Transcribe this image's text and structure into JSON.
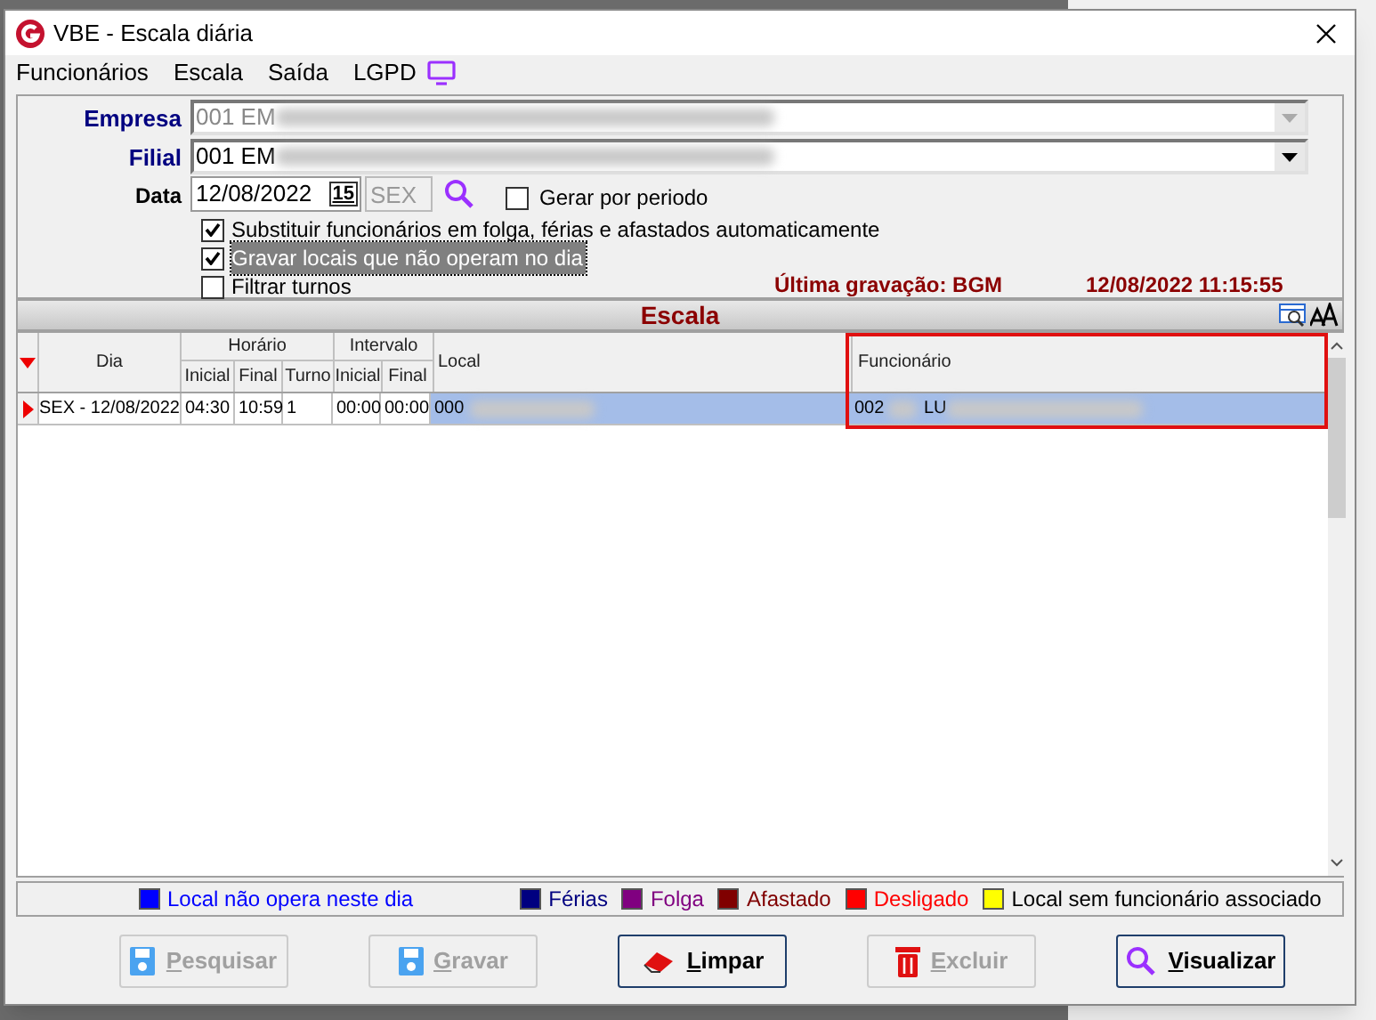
{
  "window": {
    "title": "VBE - Escala diária"
  },
  "menu": [
    "Funcionários",
    "Escala",
    "Saída",
    "LGPD"
  ],
  "form": {
    "empresa": {
      "label": "Empresa",
      "value": "001 EM",
      "disabled": true
    },
    "filial": {
      "label": "Filial",
      "value": "001 EM",
      "disabled": false
    },
    "data": {
      "label": "Data",
      "value": "12/08/2022",
      "calendar": "15",
      "weekday": "SEX"
    },
    "gerar_por_periodo": {
      "label": "Gerar por periodo",
      "checked": false
    },
    "options": [
      {
        "label": "Substituir funcionários em folga, férias e afastados automaticamente",
        "checked": true,
        "focused": false
      },
      {
        "label": "Gravar locais que não operam no dia",
        "checked": true,
        "focused": true
      },
      {
        "label": "Filtrar turnos",
        "checked": false,
        "focused": false
      }
    ],
    "last_save": {
      "label": "Última gravação: BGM",
      "timestamp": "12/08/2022 11:15:55"
    }
  },
  "grid": {
    "title": "Escala",
    "headers": {
      "dia": "Dia",
      "horario": "Horário",
      "intervalo": "Intervalo",
      "inicial": "Inicial",
      "final": "Final",
      "turno": "Turno",
      "inicial_2": "Inicial",
      "final_2": "Final",
      "local": "Local",
      "funcionario": "Funcionário"
    },
    "rows": [
      {
        "selected": true,
        "dia": "SEX - 12/08/2022",
        "inicial": "04:30",
        "final": "10:59",
        "turno": "1",
        "inicial_2": "00:00",
        "final_2": "00:00",
        "local": "000",
        "funcionario": "002",
        "funcionario_name": "LU"
      }
    ]
  },
  "legend": [
    {
      "label": "Local não opera neste dia",
      "color": "#0000ff"
    },
    {
      "label": "Férias",
      "color": "#000080"
    },
    {
      "label": "Folga",
      "color": "#800080"
    },
    {
      "label": "Afastado",
      "color": "#800000"
    },
    {
      "label": "Desligado",
      "color": "#ff0000"
    },
    {
      "label": "Local sem funcionário associado",
      "color": "#ffff00"
    }
  ],
  "buttons": [
    {
      "label": "Pesquisar",
      "kind": "disk",
      "disabled": true
    },
    {
      "label": "Gravar",
      "kind": "disk",
      "disabled": true
    },
    {
      "label": "Limpar",
      "kind": "eraser",
      "disabled": false
    },
    {
      "label": "Excluir",
      "kind": "trash",
      "disabled": true
    },
    {
      "label": "Visualizar",
      "kind": "search",
      "disabled": false
    }
  ]
}
